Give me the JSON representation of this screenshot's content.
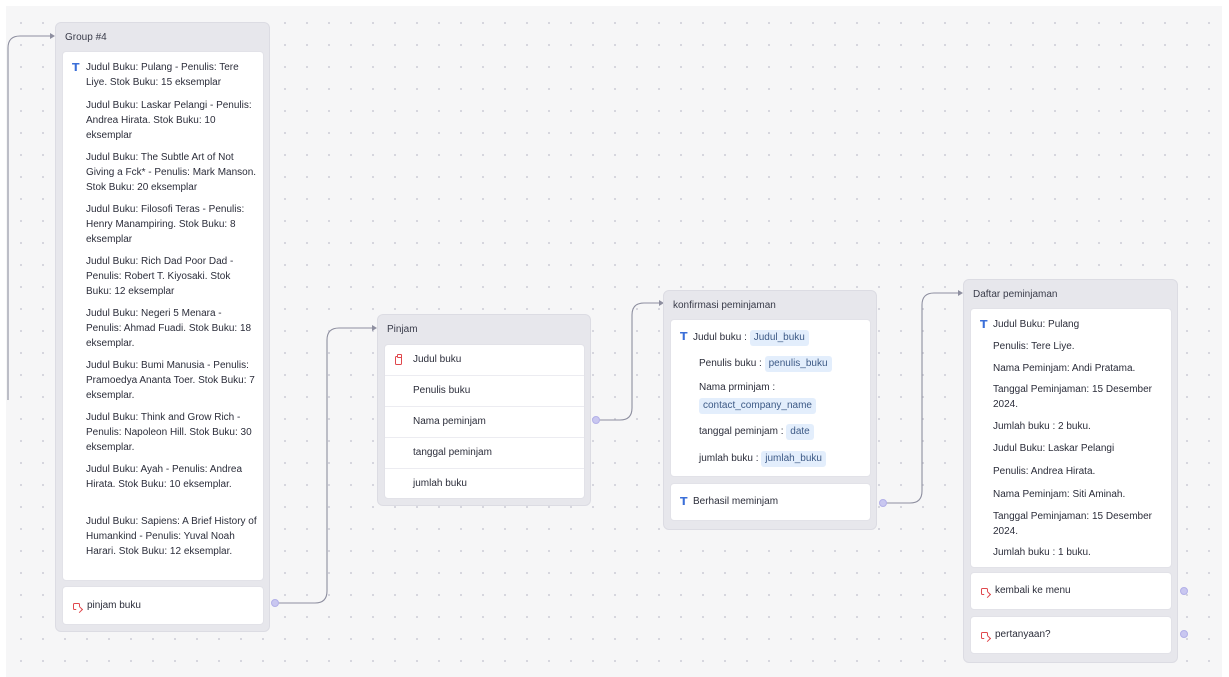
{
  "groups": {
    "group4": {
      "title": "Group #4",
      "books": [
        "Judul Buku: Pulang - Penulis: Tere Liye. Stok Buku: 15 eksemplar",
        "Judul Buku: Laskar Pelangi - Penulis: Andrea Hirata. Stok Buku: 10 eksemplar",
        "Judul Buku: The Subtle Art of Not Giving a Fck* - Penulis: Mark Manson. Stok Buku: 20 eksemplar",
        "Judul Buku: Filosofi Teras - Penulis: Henry Manampiring. Stok Buku: 8 eksemplar",
        "Judul Buku: Rich Dad Poor Dad - Penulis: Robert T. Kiyosaki. Stok Buku: 12 eksemplar",
        "Judul Buku: Negeri 5 Menara - Penulis: Ahmad Fuadi. Stok Buku: 18 eksemplar.",
        "Judul Buku: Bumi Manusia - Penulis: Pramoedya Ananta Toer. Stok Buku: 7 eksemplar.",
        "Judul Buku: Think and Grow Rich - Penulis: Napoleon Hill. Stok Buku: 30 eksemplar.",
        "Judul Buku: Ayah - Penulis: Andrea Hirata. Stok Buku: 10 eksemplar.",
        "Judul Buku: Sapiens: A Brief History of Humankind - Penulis: Yuval Noah Harari. Stok Buku: 12 eksemplar."
      ],
      "button": "pinjam buku"
    },
    "pinjam": {
      "title": "Pinjam",
      "fields": [
        "Judul buku",
        "Penulis buku",
        "Nama peminjam",
        "tanggal peminjam",
        "jumlah buku"
      ]
    },
    "konfirmasi": {
      "title": "konfirmasi peminjaman",
      "rows": [
        {
          "label": "Judul buku :",
          "var": "Judul_buku"
        },
        {
          "label": "Penulis buku :",
          "var": "penulis_buku"
        },
        {
          "label": "Nama prminjam :",
          "var": "contact_company_name"
        },
        {
          "label": "tanggal peminjam :",
          "var": "date"
        },
        {
          "label": "jumlah buku :",
          "var": "jumlah_buku"
        }
      ],
      "success": "Berhasil meminjam"
    },
    "daftar": {
      "title": "Daftar peminjaman",
      "lines": [
        "Judul Buku: Pulang",
        "Penulis: Tere Liye.",
        "Nama Peminjam: Andi Pratama.",
        "Tanggal Peminjaman: 15 Desember 2024.",
        "Jumlah buku : 2 buku.",
        "Judul Buku: Laskar Pelangi",
        "Penulis: Andrea Hirata.",
        "Nama Peminjam: Siti Aminah.",
        "Tanggal Peminjaman: 15 Desember 2024.",
        "Jumlah buku : 1 buku."
      ],
      "buttons": [
        "kembali ke menu",
        "pertanyaan?"
      ]
    }
  },
  "colors": {
    "canvas": "#f6f6f7",
    "group_bg": "#e7e7ec",
    "edge": "#8e8fa0",
    "handle": "#c9c7f0",
    "text_icon": "#3b6fd8",
    "button_icon": "#e0474c",
    "chip_bg": "#e3eefc"
  }
}
